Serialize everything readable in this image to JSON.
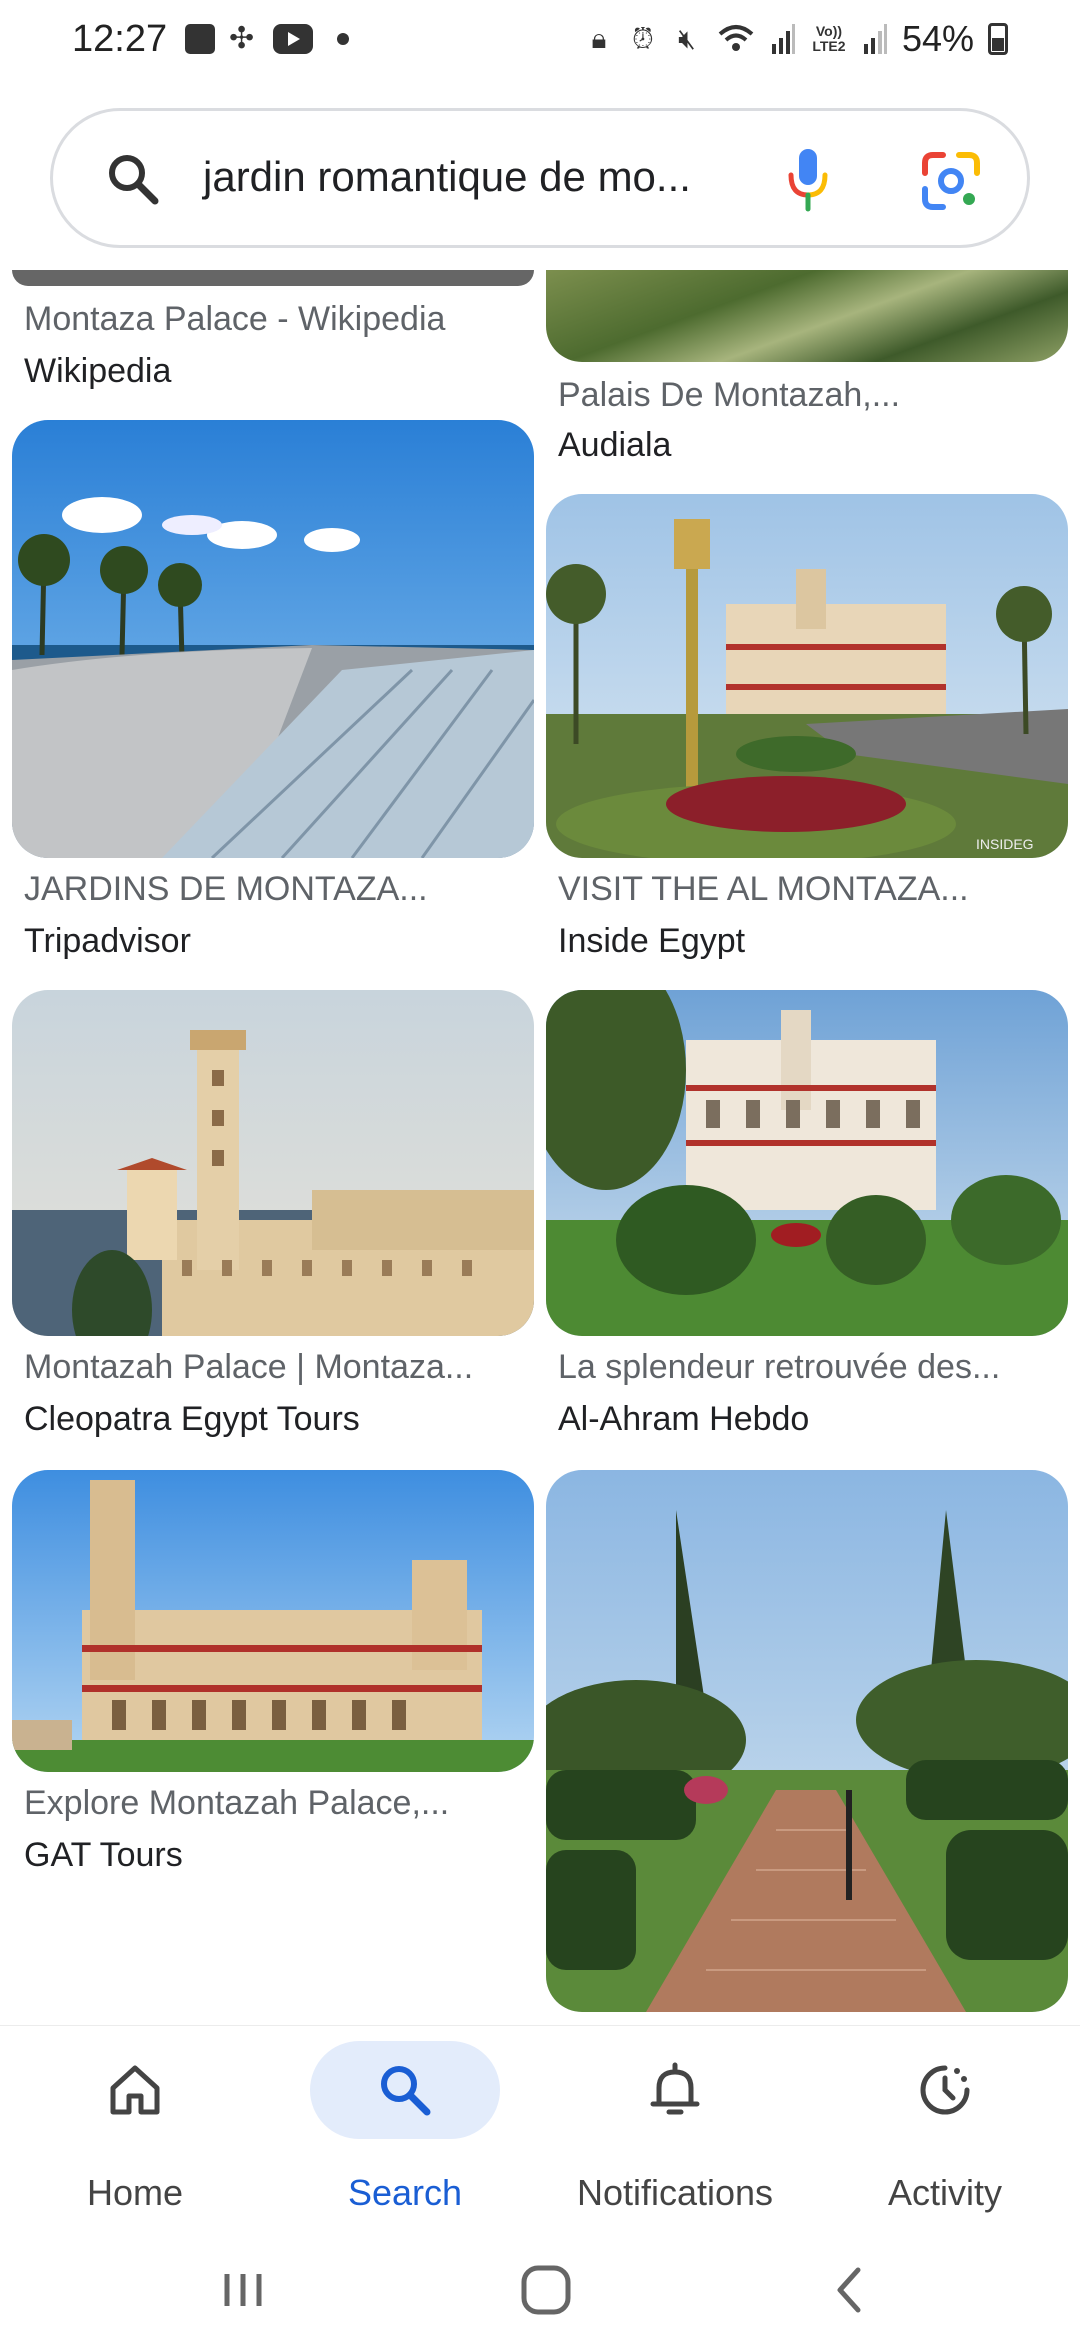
{
  "status_bar": {
    "time": "12:27",
    "battery": "54%",
    "icons": [
      "gallery-icon",
      "fan-icon",
      "youtube-icon",
      "dot-icon",
      "lock-icon",
      "alarm-icon",
      "mute-icon",
      "wifi-icon",
      "signal-icon",
      "volte-icon",
      "signal-icon",
      "battery-icon"
    ],
    "volte_label": "Vo)) LTE2"
  },
  "search": {
    "query": "jardin romantique de mo..."
  },
  "results": [
    {
      "title": "Montaza Palace - Wikipedia",
      "source": "Wikipedia"
    },
    {
      "title": "Palais De Montazah,...",
      "source": "Audiala"
    },
    {
      "title": "JARDINS DE MONTAZA...",
      "source": "Tripadvisor"
    },
    {
      "title": "VISIT THE AL MONTAZA...",
      "source": "Inside Egypt",
      "watermark": "INSIDEG"
    },
    {
      "title": "Montazah Palace | Montaza...",
      "source": "Cleopatra Egypt Tours"
    },
    {
      "title": "La splendeur retrouvée des...",
      "source": "Al-Ahram Hebdo"
    },
    {
      "title": "Explore Montazah Palace,...",
      "source": "GAT Tours"
    },
    {
      "title": "",
      "source": ""
    }
  ],
  "bottom_nav": {
    "items": [
      {
        "label": "Home",
        "icon": "home-icon",
        "active": false
      },
      {
        "label": "Search",
        "icon": "search-icon",
        "active": true
      },
      {
        "label": "Notifications",
        "icon": "bell-icon",
        "active": false
      },
      {
        "label": "Activity",
        "icon": "activity-icon",
        "active": false
      }
    ]
  },
  "colors": {
    "accent": "#1a5ed4",
    "active_pill": "#e3ecfb"
  }
}
